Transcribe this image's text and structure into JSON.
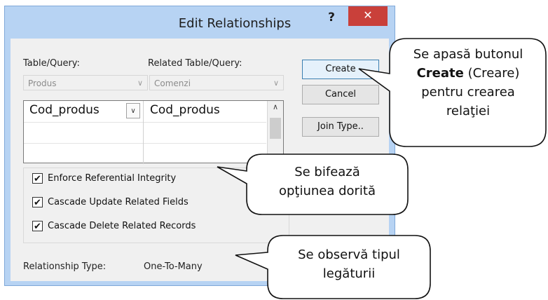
{
  "dialog": {
    "title": "Edit Relationships",
    "help_label": "?",
    "close_label": "✕",
    "table_query_label": "Table/Query:",
    "related_table_label": "Related Table/Query:",
    "table_value": "Produs",
    "related_table_value": "Comenzi",
    "grid_rows": [
      {
        "left": "Cod_produs",
        "right": "Cod_produs"
      },
      {
        "left": "",
        "right": ""
      },
      {
        "left": "",
        "right": ""
      }
    ],
    "buttons": {
      "create": "Create",
      "cancel": "Cancel",
      "join_type": "Join Type.."
    },
    "checkboxes": [
      {
        "label": "Enforce Referential Integrity",
        "checked": true
      },
      {
        "label": "Cascade Update Related Fields",
        "checked": true
      },
      {
        "label": "Cascade Delete Related Records",
        "checked": true
      }
    ],
    "relationship_type_label": "Relationship Type:",
    "relationship_type_value": "One-To-Many"
  },
  "callouts": {
    "create": {
      "before": "Se apasă butonul",
      "bold": "Create",
      "after": "(Creare)",
      "line3": "pentru crearea",
      "line4": "relaţiei"
    },
    "options": {
      "line1": "Se bifează",
      "line2": "opţiunea dorită"
    },
    "type": {
      "line1": "Se observă tipul",
      "line2": "legăturii"
    }
  },
  "colors": {
    "title_bg": "#b7d3f3",
    "close_bg": "#c9403a",
    "client_bg": "#f0f0f0"
  }
}
